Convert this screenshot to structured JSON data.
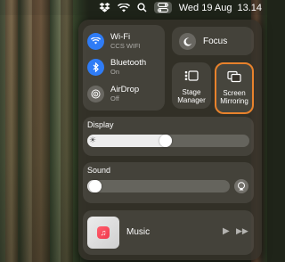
{
  "menubar": {
    "date": "Wed 19 Aug",
    "time": "13.14",
    "icons": [
      "dropbox-icon",
      "wifi-icon",
      "search-icon",
      "control-center-icon"
    ]
  },
  "control_center": {
    "wifi": {
      "label": "Wi-Fi",
      "status": "CCS WIFI"
    },
    "bluetooth": {
      "label": "Bluetooth",
      "status": "On"
    },
    "airdrop": {
      "label": "AirDrop",
      "status": "Off"
    },
    "focus": {
      "label": "Focus"
    },
    "stage_manager": {
      "label_line1": "Stage",
      "label_line2": "Manager"
    },
    "screen_mirroring": {
      "label_line1": "Screen",
      "label_line2": "Mirroring",
      "highlight_color": "#e8822c"
    },
    "display": {
      "title": "Display",
      "level": 0.52
    },
    "sound": {
      "title": "Sound",
      "level": 0.0
    },
    "music": {
      "label": "Music"
    }
  },
  "colors": {
    "accent_blue": "#2f7cf6",
    "highlight_orange": "#e8822c"
  }
}
